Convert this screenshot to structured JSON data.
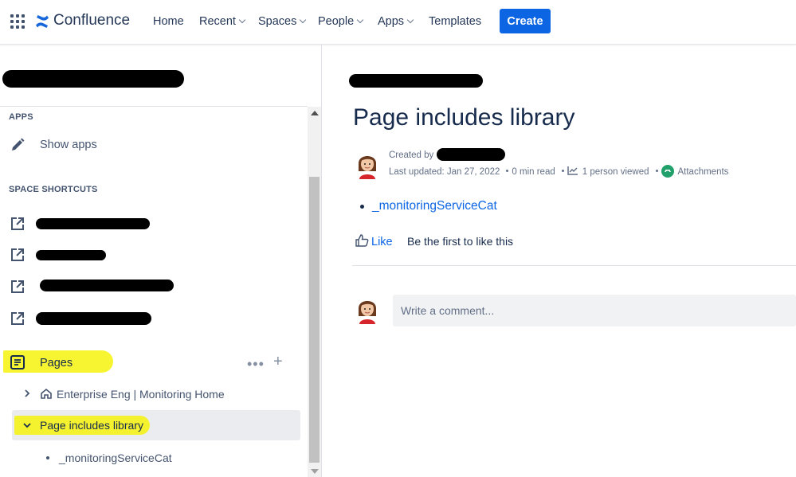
{
  "topnav": {
    "brand": "Confluence",
    "items": [
      {
        "label": "Home",
        "dropdown": false
      },
      {
        "label": "Recent",
        "dropdown": true
      },
      {
        "label": "Spaces",
        "dropdown": true
      },
      {
        "label": "People",
        "dropdown": true
      },
      {
        "label": "Apps",
        "dropdown": true
      },
      {
        "label": "Templates",
        "dropdown": false
      }
    ],
    "create_label": "Create"
  },
  "sidebar": {
    "apps_heading": "APPS",
    "show_apps": "Show apps",
    "shortcuts_heading": "SPACE SHORTCUTS",
    "pages_label": "Pages",
    "pages_more": "•••",
    "pages_add": "+",
    "tree": {
      "home": "Enterprise Eng | Monitoring Home",
      "current": "Page includes library",
      "child": "_monitoringServiceCat"
    }
  },
  "content": {
    "title": "Page includes library",
    "created_by": "Created by",
    "last_updated": "Last updated: Jan 27, 2022",
    "read_time": "0 min read",
    "viewed": "1 person viewed",
    "attachments": "Attachments",
    "child_link": "_monitoringServiceCat",
    "like_label": "Like",
    "like_prompt": "Be the first to like this",
    "comment_placeholder": "Write a comment..."
  },
  "colors": {
    "primary": "#0c66e4",
    "highlight": "#f6f30d",
    "text": "#172b4d",
    "subtle_text": "#626f86"
  }
}
